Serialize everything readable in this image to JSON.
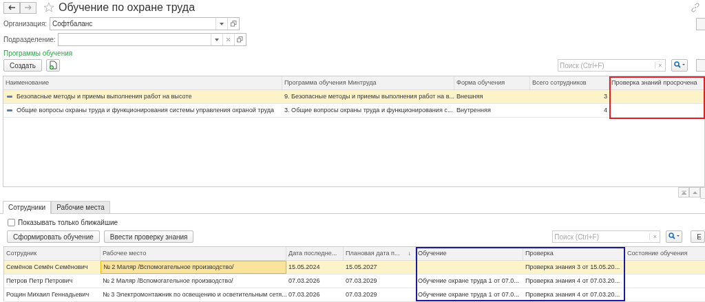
{
  "window": {
    "title": "Обучение по охране труда",
    "favorite": false
  },
  "organization": {
    "label": "Организация:",
    "value": "Софтбаланс"
  },
  "department": {
    "label": "Подразделение:"
  },
  "programs": {
    "title": "Программы обучения",
    "create_button": "Создать",
    "search": {
      "placeholder": "Поиск (Ctrl+F)",
      "clear": "×"
    },
    "table": {
      "columns": [
        {
          "label": "Наименование",
          "kind": "text",
          "highlighted": false
        },
        {
          "label": "Программа обучения Минтруда",
          "kind": "text",
          "highlighted": false
        },
        {
          "label": "Форма обучения",
          "kind": "text",
          "highlighted": false
        },
        {
          "label": "Всего сотрудников",
          "kind": "number",
          "highlighted": false
        },
        {
          "label": "Проверка знаний просрочена",
          "kind": "text",
          "highlighted": true
        }
      ],
      "rows": [
        {
          "selected": true,
          "cells": [
            "Безопасные методы и приемы выполнения работ на высоте",
            "9. Безопасные методы и приемы выполнения работ на в...",
            "Внешняя",
            "3",
            ""
          ]
        },
        {
          "selected": false,
          "cells": [
            "Общие вопросы охраны труда и функционирования системы управления охраной труда",
            "3. Общие вопросы охраны труда и функционирования с...",
            "Внутренняя",
            "4",
            ""
          ]
        }
      ]
    }
  },
  "tabs": [
    {
      "label": "Сотрудники",
      "selected": true
    },
    {
      "label": "Рабочие места",
      "selected": false
    }
  ],
  "nearest_only": {
    "label": "Показывать только ближайшие",
    "checked": false
  },
  "actions": [
    "Сформировать обучение",
    "Ввести проверку знания"
  ],
  "employees": {
    "search": {
      "placeholder": "Поиск (Ctrl+F)",
      "clear": "×"
    },
    "more_button": "Е",
    "table": {
      "columns": [
        {
          "label": "Сотрудник",
          "highlighted": false
        },
        {
          "label": "Рабочее место",
          "highlighted": false
        },
        {
          "label": "Дата последне...",
          "highlighted": false
        },
        {
          "label": "Плановая дата п...",
          "sort_mark": "↓",
          "highlighted": false
        },
        {
          "label": "Обучение",
          "highlighted": true
        },
        {
          "label": "Проверка",
          "highlighted": true
        },
        {
          "label": "Состояние обучения",
          "highlighted": false
        }
      ],
      "rows": [
        {
          "selected": true,
          "cells": [
            {
              "text": "Семёнов Семён Семёнович",
              "focused": false
            },
            {
              "text": "№ 2 Маляр /Вспомогательное производство/",
              "focused": true
            },
            {
              "text": "15.05.2024",
              "focused": false
            },
            {
              "text": "15.05.2027",
              "focused": false
            },
            {
              "text": "",
              "focused": false
            },
            {
              "text": "Проверка знания 3 от 15.05.20...",
              "focused": false
            },
            {
              "text": "",
              "focused": false
            }
          ]
        },
        {
          "selected": false,
          "cells": [
            {
              "text": "Петров Петр Петрович",
              "focused": false
            },
            {
              "text": "№ 2 Маляр /Вспомогательное производство/",
              "focused": false
            },
            {
              "text": "07.03.2026",
              "focused": false
            },
            {
              "text": "07.03.2029",
              "focused": false
            },
            {
              "text": "Обучение охране труда 1 от 07.0...",
              "focused": false
            },
            {
              "text": "Проверка знания 4 от 07.03.20...",
              "focused": false
            },
            {
              "text": "",
              "focused": false
            }
          ]
        },
        {
          "selected": false,
          "cells": [
            {
              "text": "Рощин Михаил Геннадьевич",
              "focused": false
            },
            {
              "text": "№ 3 Электромонтажник по освещению и осветительным сетя...",
              "focused": false
            },
            {
              "text": "07.03.2026",
              "focused": false
            },
            {
              "text": "07.03.2029",
              "focused": false
            },
            {
              "text": "Обучение охране труда 1 от 07.0...",
              "focused": false
            },
            {
              "text": "Проверка знания 4 от 07.03.20...",
              "focused": false
            },
            {
              "text": "",
              "focused": false
            }
          ]
        }
      ]
    }
  }
}
